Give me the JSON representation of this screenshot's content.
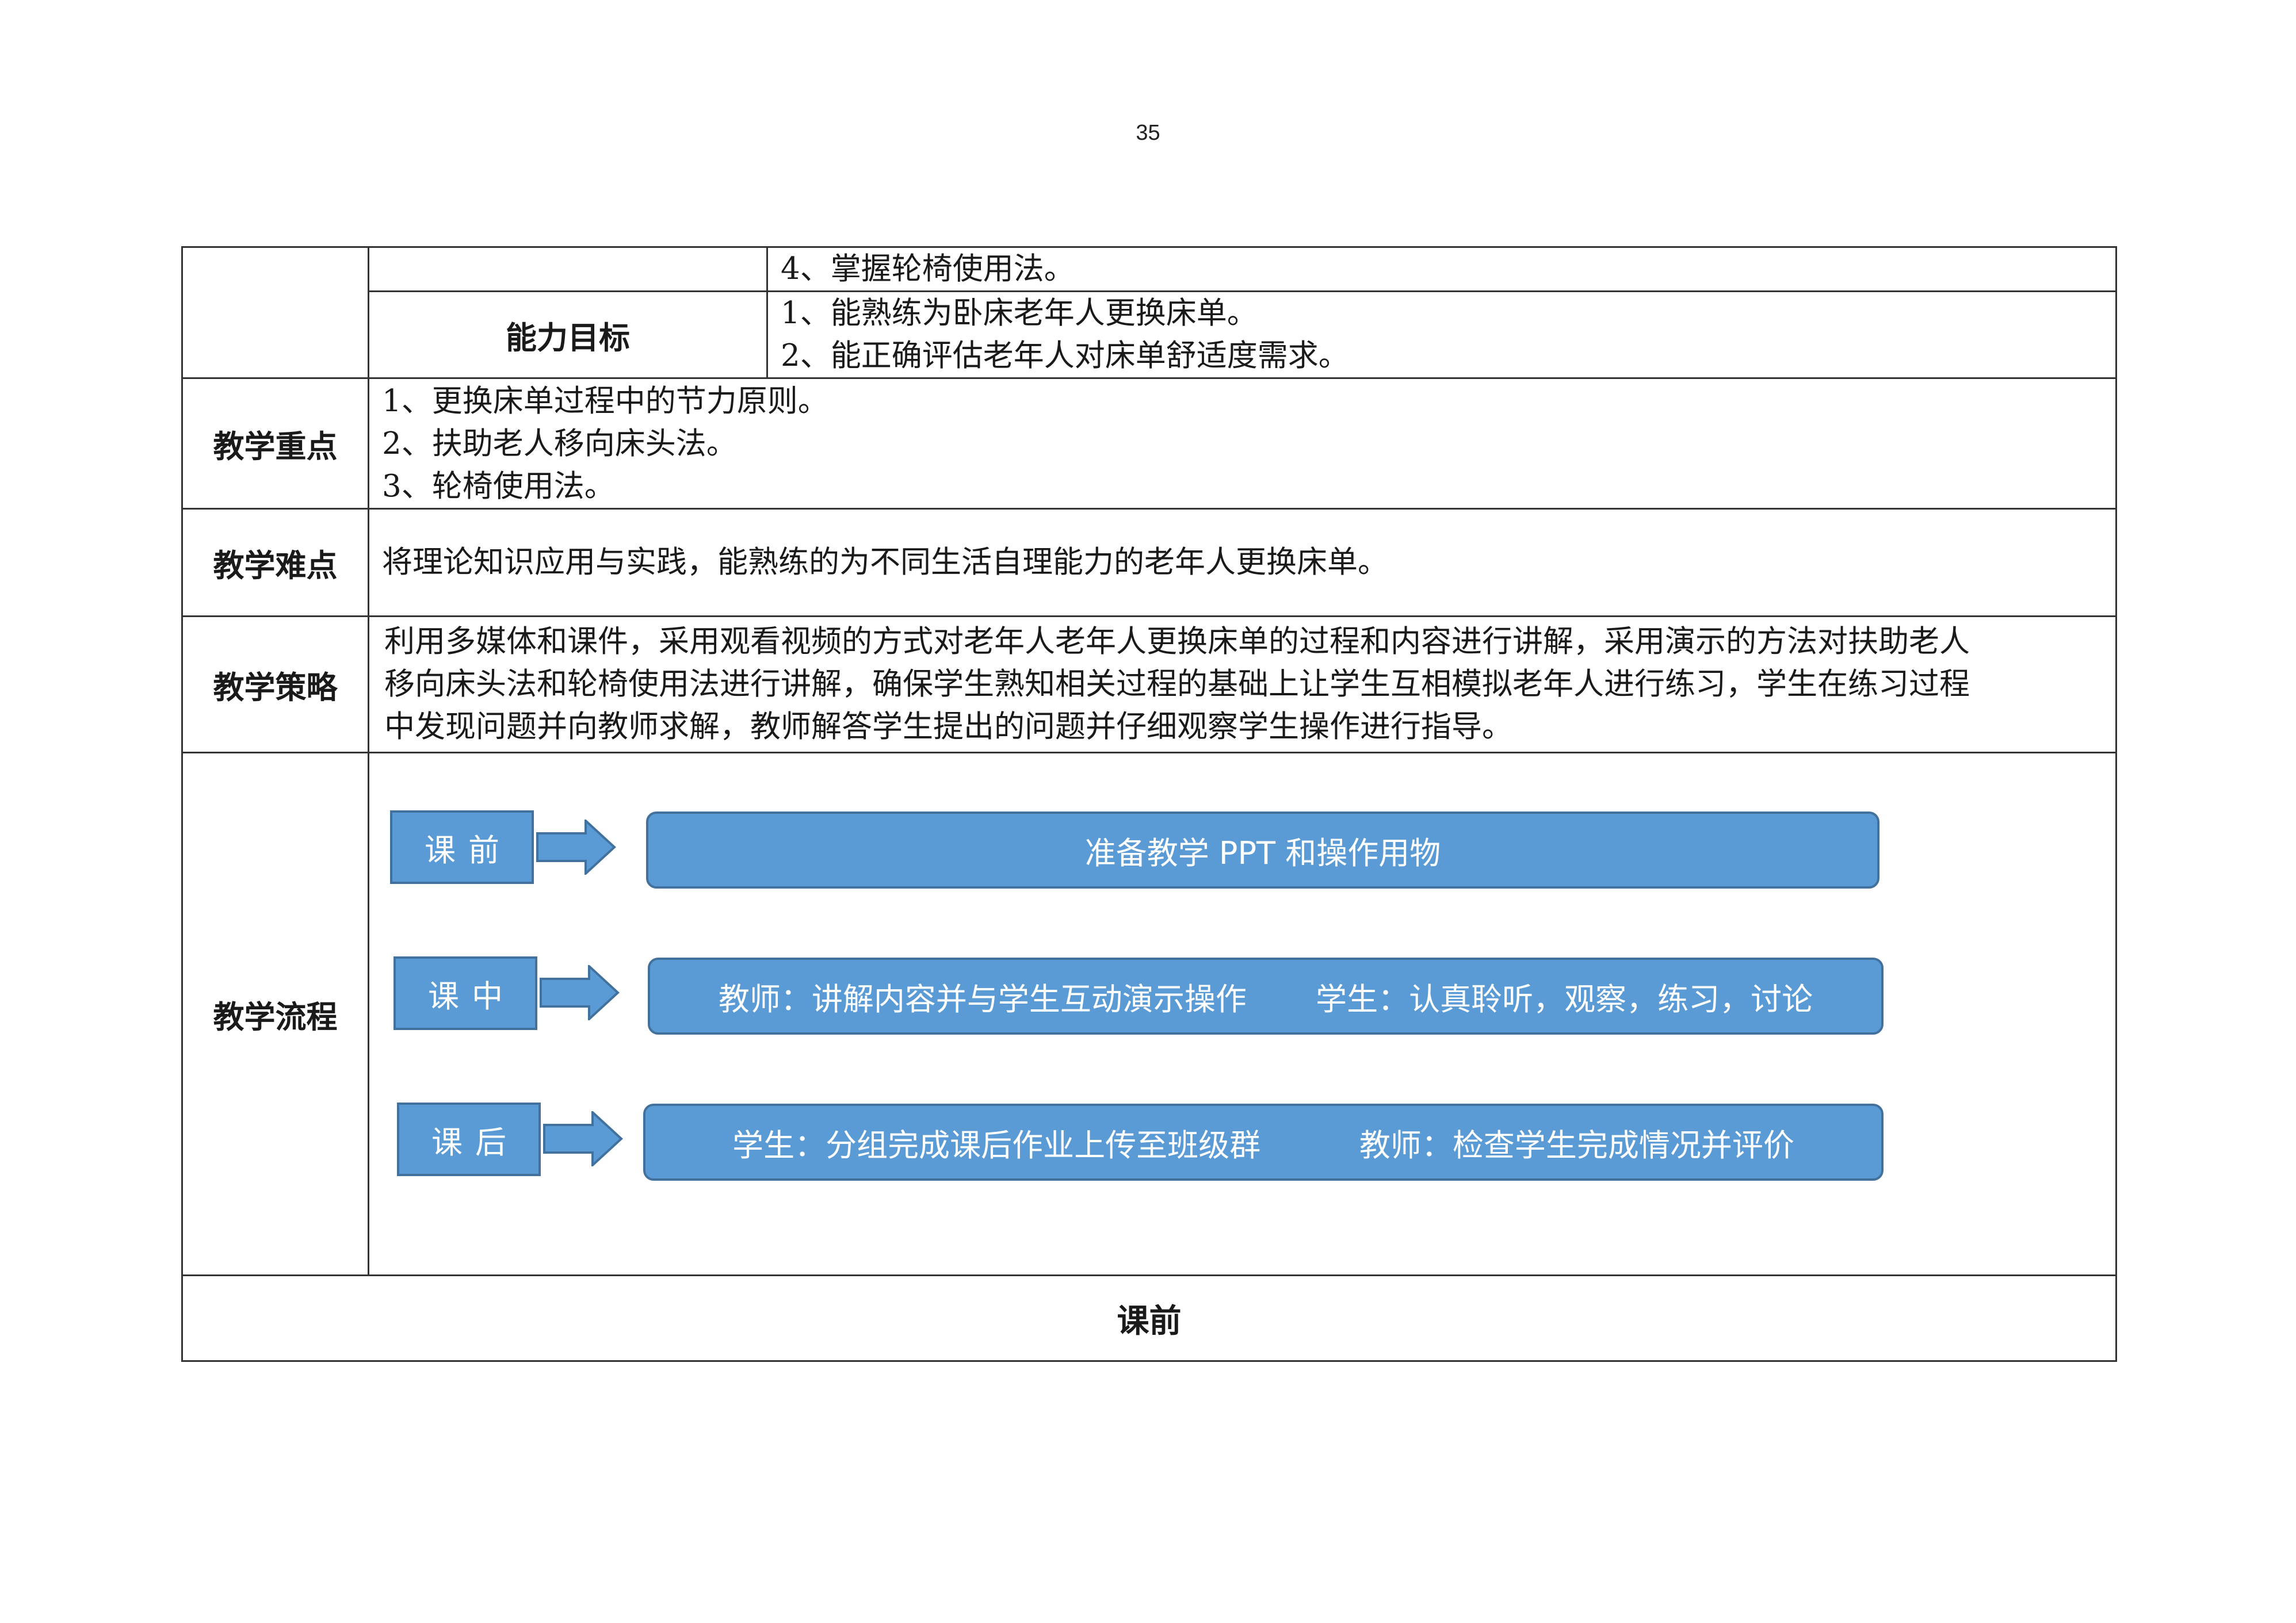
{
  "page_number": "35",
  "objectives": {
    "knowledge_last_item": "4、掌握轮椅使用法。",
    "ability_label": "能力目标",
    "ability_items": [
      "1、能熟练为卧床老年人更换床单。",
      "2、能正确评估老年人对床单舒适度需求。"
    ]
  },
  "key_points": {
    "label": "教学重点",
    "items": [
      "1、更换床单过程中的节力原则。",
      "2、扶助老人移向床头法。",
      "3、轮椅使用法。"
    ]
  },
  "difficulties": {
    "label": "教学难点",
    "text": "将理论知识应用与实践，能熟练的为不同生活自理能力的老年人更换床单。"
  },
  "strategy": {
    "label": "教学策略",
    "lines": [
      "利用多媒体和课件，采用观看视频的方式对老年人老年人更换床单的过程和内容进行讲解，采用演示的方法对扶助老人",
      "移向床头法和轮椅使用法进行讲解，确保学生熟知相关过程的基础上让学生互相模拟老年人进行练习，学生在练习过程",
      "中发现问题并向教师求解，教师解答学生提出的问题并仔细观察学生操作进行指导。"
    ]
  },
  "process": {
    "label": "教学流程",
    "stages": [
      {
        "name": "课前",
        "content": "准备教学 PPT 和操作用物"
      },
      {
        "name": "课中",
        "content": "教师：讲解内容并与学生互动演示操作       学生：认真聆听，观察，练习，讨论"
      },
      {
        "name": "课后",
        "content": "学生：分组完成课后作业上传至班级群          教师：检查学生完成情况并评价"
      }
    ],
    "colors": {
      "box_fill": "#5b9bd5",
      "box_border": "#41719c",
      "text": "#ffffff"
    }
  },
  "footer_heading": "课前"
}
